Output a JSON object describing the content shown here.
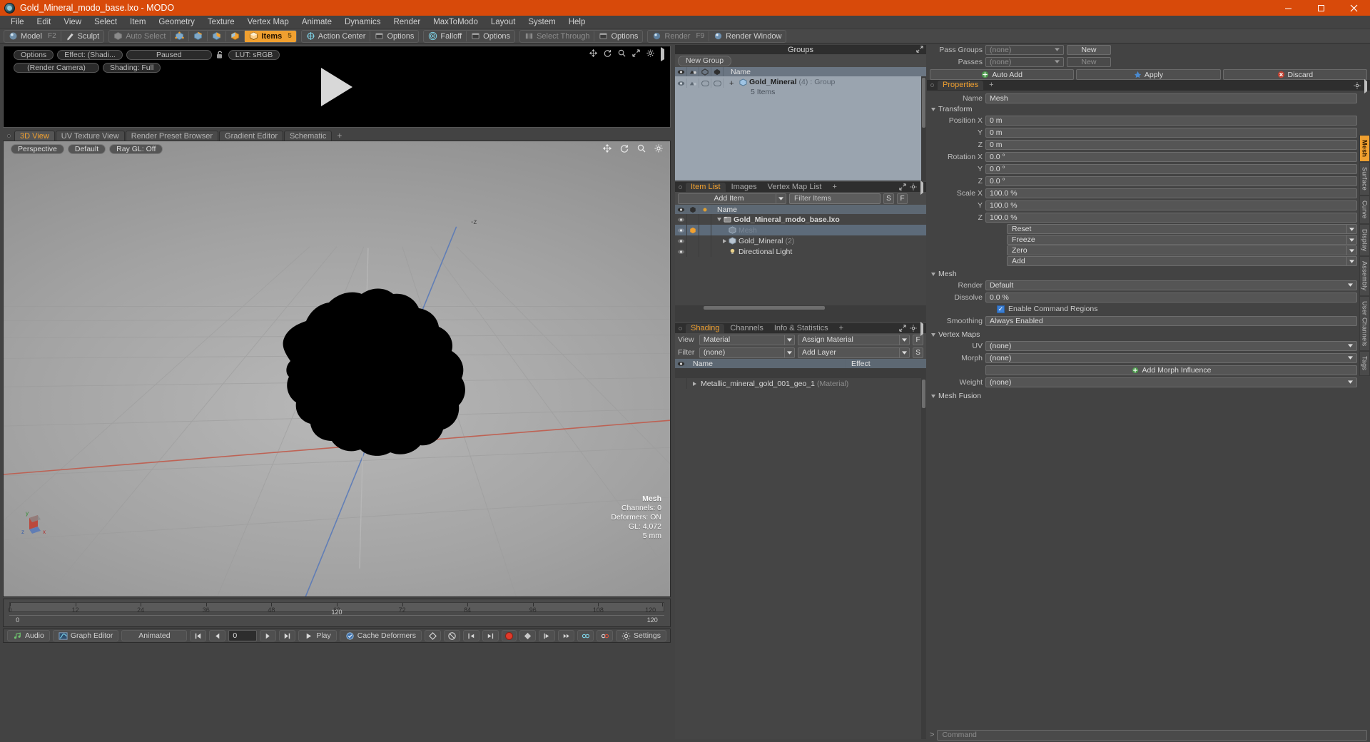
{
  "window": {
    "title": "Gold_Mineral_modo_base.lxo - MODO",
    "accent": "#d84a0a",
    "controls": [
      "minimize",
      "maximize",
      "close"
    ]
  },
  "menu": [
    "File",
    "Edit",
    "View",
    "Select",
    "Item",
    "Geometry",
    "Texture",
    "Vertex Map",
    "Animate",
    "Dynamics",
    "Render",
    "MaxToModo",
    "Layout",
    "System",
    "Help"
  ],
  "toolbar": {
    "mode_group": [
      {
        "label": "Model",
        "key": "F2",
        "icon": "sphere-icon",
        "state": "normal"
      },
      {
        "label": "Sculpt",
        "key": "",
        "icon": "brush-icon",
        "state": "normal"
      }
    ],
    "select_group": [
      {
        "label": "Auto Select",
        "key": "",
        "icon": "cube-icon",
        "state": "dim"
      },
      {
        "label": "",
        "key": "",
        "icon": "vertex-icon",
        "state": "normal"
      },
      {
        "label": "",
        "key": "",
        "icon": "edge-icon",
        "state": "normal"
      },
      {
        "label": "",
        "key": "",
        "icon": "polygon-icon",
        "state": "normal"
      },
      {
        "label": "",
        "key": "",
        "icon": "material-icon",
        "state": "normal"
      },
      {
        "label": "Items",
        "key": "5",
        "icon": "items-icon",
        "state": "active"
      }
    ],
    "action_group": [
      {
        "label": "Action Center",
        "key": "",
        "icon": "action-center-icon",
        "state": "normal"
      },
      {
        "label": "Options",
        "key": "",
        "icon": "options-icon",
        "state": "normal"
      }
    ],
    "falloff_group": [
      {
        "label": "Falloff",
        "key": "",
        "icon": "falloff-icon",
        "state": "normal"
      },
      {
        "label": "Options",
        "key": "",
        "icon": "options-icon",
        "state": "normal"
      }
    ],
    "through_group": [
      {
        "label": "Select Through",
        "key": "",
        "icon": "select-through-icon",
        "state": "dim"
      },
      {
        "label": "Options",
        "key": "",
        "icon": "options-icon",
        "state": "normal"
      }
    ],
    "render_group": [
      {
        "label": "Render",
        "key": "F9",
        "icon": "render-icon",
        "state": "dim"
      },
      {
        "label": "Render Window",
        "key": "",
        "icon": "render-window-icon",
        "state": "normal"
      }
    ]
  },
  "render_preview": {
    "buttons": [
      "Options",
      "Effect: (Shadi...",
      "Paused"
    ],
    "lock_icon": "unlocked-padlock-icon",
    "lut": "LUT: sRGB",
    "camera": "(Render Camera)",
    "shading": "Shading: Full",
    "corner_icons": [
      "move-icon",
      "rotate-icon",
      "zoom-icon",
      "fit-icon",
      "gear-icon",
      "chevron-right-icon"
    ],
    "center_glyph": "play-triangle-icon"
  },
  "viewport_tabs": {
    "tabs": [
      "3D View",
      "UV Texture View",
      "Render Preset Browser",
      "Gradient Editor",
      "Schematic"
    ],
    "selected": "3D View",
    "add_label": "+"
  },
  "viewport": {
    "buttons": [
      "Perspective",
      "Default",
      "Ray GL: Off"
    ],
    "corner_icons": [
      "move-icon",
      "rotate-icon",
      "zoom-icon",
      "gear-icon"
    ],
    "axis_label_neg_z": "-z",
    "gizmo_axes": [
      "y",
      "x",
      "z"
    ],
    "stats": {
      "title": "Mesh",
      "channels": "Channels: 0",
      "deformers": "Deformers: ON",
      "gl": "GL: 4,072",
      "size": "5 mm"
    }
  },
  "ruler": {
    "top_ticks": [
      "0",
      "12",
      "24",
      "36",
      "48",
      "60",
      "72",
      "84",
      "96",
      "108",
      "120"
    ],
    "bottom_center": "120",
    "bottom_left": "0",
    "bottom_right": "120"
  },
  "transport": {
    "audio": "Audio",
    "graph_editor": "Graph Editor",
    "animated": "Animated",
    "frame_value": "0",
    "play": "Play",
    "cache_deformers": "Cache Deformers",
    "settings": "Settings",
    "record_color": "#e03a2a"
  },
  "groups_panel": {
    "title": "Groups",
    "new_group_button": "New Group",
    "columns": [
      "eye-column",
      "render-column",
      "shade-column",
      "select-column",
      "Name"
    ],
    "rows": [
      {
        "name": "Gold_Mineral",
        "count": "(4)",
        "type": ": Group",
        "sub": "5 Items",
        "icon": "group-icon",
        "expander": "+"
      }
    ]
  },
  "item_list": {
    "tabs": [
      "Item List",
      "Images",
      "Vertex Map List"
    ],
    "selected_tab": "Item List",
    "add_label": "+",
    "add_item_button": "Add Item",
    "filter_placeholder": "Filter Items",
    "filter_buttons": [
      "S",
      "F"
    ],
    "column_name": "Name",
    "rows": [
      {
        "name": "Gold_Mineral_modo_base.lxo",
        "suffix": "",
        "icon": "scene-icon",
        "indent": 0,
        "expander": "down",
        "selected": false
      },
      {
        "name": "Mesh",
        "suffix": "",
        "icon": "mesh-icon",
        "indent": 1,
        "expander": "none",
        "selected": true
      },
      {
        "name": "Gold_Mineral",
        "suffix": "(2)",
        "icon": "group-icon",
        "indent": 1,
        "expander": "right",
        "selected": false
      },
      {
        "name": "Directional Light",
        "suffix": "",
        "icon": "light-icon",
        "indent": 1,
        "expander": "none",
        "selected": false
      }
    ]
  },
  "shading_panel": {
    "tabs": [
      "Shading",
      "Channels",
      "Info & Statistics"
    ],
    "selected_tab": "Shading",
    "add_label": "+",
    "view_label": "View",
    "view_value": "Material",
    "assign_value": "Assign Material",
    "assign_button": "F",
    "filter_label": "Filter",
    "filter_value": "(none)",
    "add_layer_value": "Add Layer",
    "add_layer_button": "S",
    "columns": [
      "Name",
      "Effect"
    ],
    "rows": [
      {
        "name": "Metallic_mineral_gold_001_geo_1",
        "note": "(Material)",
        "effect": "",
        "icon": "material-sphere-icon"
      }
    ]
  },
  "properties": {
    "pass_groups_label": "Pass Groups",
    "pass_groups_value": "(none)",
    "pass_groups_button": "New",
    "passes_label": "Passes",
    "passes_value": "(none)",
    "passes_button": "New",
    "auto_add": "Auto Add",
    "apply": "Apply",
    "discard": "Discard",
    "tab": "Properties",
    "add_label": "+",
    "name_label": "Name",
    "name_value": "Mesh",
    "sections": {
      "transform": {
        "title": "Transform",
        "rows": [
          {
            "label": "Position X",
            "value": "0 m"
          },
          {
            "label": "Y",
            "value": "0 m"
          },
          {
            "label": "Z",
            "value": "0 m"
          },
          {
            "label": "Rotation X",
            "value": "0.0 °"
          },
          {
            "label": "Y",
            "value": "0.0 °"
          },
          {
            "label": "Z",
            "value": "0.0 °"
          },
          {
            "label": "Scale X",
            "value": "100.0 %"
          },
          {
            "label": "Y",
            "value": "100.0 %"
          },
          {
            "label": "Z",
            "value": "100.0 %"
          }
        ],
        "buttons": [
          "Reset",
          "Freeze",
          "Zero",
          "Add"
        ]
      },
      "mesh": {
        "title": "Mesh",
        "render_label": "Render",
        "render_value": "Default",
        "dissolve_label": "Dissolve",
        "dissolve_value": "0.0 %",
        "command_regions": "Enable Command Regions",
        "command_regions_checked": true,
        "smoothing_label": "Smoothing",
        "smoothing_value": "Always Enabled"
      },
      "vertex_maps": {
        "title": "Vertex Maps",
        "rows": [
          {
            "label": "UV",
            "value": "(none)"
          },
          {
            "label": "Morph",
            "value": "(none)"
          },
          {
            "label": "Weight",
            "value": "(none)"
          }
        ],
        "morph_influence": "Add Morph Influence"
      },
      "mesh_fusion": {
        "title": "Mesh Fusion"
      }
    },
    "side_tabs": [
      "Mesh",
      "Surface",
      "Curve",
      "Display",
      "Assembly",
      "User Channels",
      "Tags"
    ],
    "side_tab_selected": "Mesh"
  },
  "command_bar": {
    "placeholder": "Command",
    "prompt": ">"
  }
}
